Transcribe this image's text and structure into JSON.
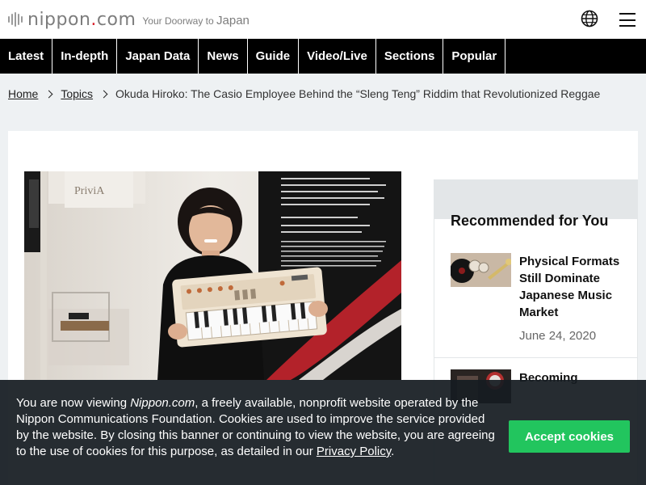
{
  "header": {
    "logo_text": "nippon",
    "logo_dot": ".",
    "logo_suffix": "com",
    "tagline_prefix": "Your Doorway",
    "tagline_to": " to ",
    "tagline_suffix": "Japan",
    "language_icon": "globe-icon",
    "menu_icon": "hamburger-menu-icon"
  },
  "nav": {
    "items": [
      "Latest",
      "In-depth",
      "Japan Data",
      "News",
      "Guide",
      "Video/Live",
      "Sections",
      "Popular"
    ]
  },
  "breadcrumb": {
    "home": "Home",
    "topics": "Topics",
    "current": "Okuda Hiroko: The Casio Employee Behind the “Sleng Teng” Riddim that Revolutionized Reggae"
  },
  "photo": {
    "brand_sign": "PriviA"
  },
  "recommended": {
    "title": "Recommended for You",
    "items": [
      {
        "title": "Physical Formats Still Dominate Japanese Music Market",
        "date": "June 24, 2020"
      },
      {
        "title": "Becoming",
        "date": ""
      }
    ]
  },
  "cookie": {
    "text_1": "You are now viewing ",
    "site_name": "Nippon.com",
    "text_2": ", a freely available, nonprofit website operated by the Nippon Communications Foundation. Cookies are used to improve the service provided by the website. By closing this banner or continuing to view the website, you are agreeing to the use of cookies for this purpose, as detailed in our ",
    "policy_link": "Privacy Policy",
    "text_3": ".",
    "accept_label": "Accept cookies"
  },
  "colors": {
    "nav_background": "#000000",
    "logo_accent": "#d9232e",
    "accept_button": "#22c55e",
    "banner_background": "#161c21"
  }
}
